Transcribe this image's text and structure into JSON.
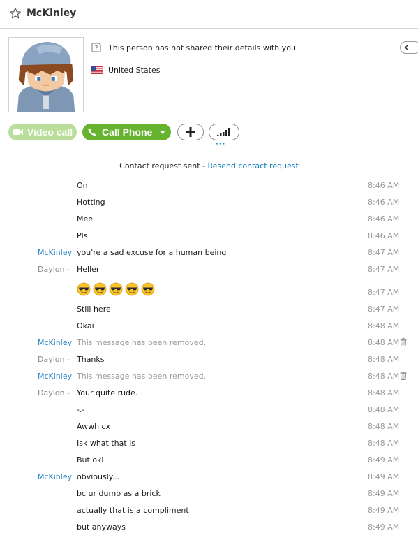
{
  "header": {
    "contact_name": "McKinley",
    "favorite_icon": "star-icon"
  },
  "profile": {
    "details_notice": "This person has not shared their details with you.",
    "country": "United States",
    "flag": "us-flag-icon",
    "avatar": "pixel-art-avatar"
  },
  "actions": {
    "video_call_label": "Video call",
    "call_phone_label": "Call Phone",
    "add_icon": "plus-icon",
    "signal_icon": "signal-icon",
    "colors": {
      "video_disabled": "#b9df9a",
      "call": "#65b32e"
    }
  },
  "conversation": {
    "contact_request_text": "Contact request sent - ",
    "resend_link": "Resend contact request",
    "messages": [
      {
        "sender": "",
        "text": "On",
        "time": "8:46 AM"
      },
      {
        "sender": "",
        "text": "Hotting",
        "time": "8:46 AM"
      },
      {
        "sender": "",
        "text": "Mee",
        "time": "8:46 AM"
      },
      {
        "sender": "",
        "text": "Pls",
        "time": "8:46 AM"
      },
      {
        "sender": "McKinley",
        "text": "you're a sad excuse for a human being",
        "time": "8:47 AM"
      },
      {
        "sender": "Daylon -",
        "text": "Heller",
        "time": "8:47 AM"
      },
      {
        "sender": "",
        "text": "",
        "emoji": "sunglasses-emoji",
        "emoji_count": 5,
        "time": "8:47 AM"
      },
      {
        "sender": "",
        "text": "Still here",
        "time": "8:47 AM"
      },
      {
        "sender": "",
        "text": "Okai",
        "time": "8:48 AM"
      },
      {
        "sender": "McKinley",
        "text": "This message has been removed.",
        "removed": true,
        "time": "8:48 AM"
      },
      {
        "sender": "Daylon -",
        "text": "Thanks",
        "time": "8:48 AM"
      },
      {
        "sender": "McKinley",
        "text": "This message has been removed.",
        "removed": true,
        "time": "8:48 AM"
      },
      {
        "sender": "Daylon -",
        "text": "Your quite rude.",
        "time": "8:48 AM"
      },
      {
        "sender": "",
        "text": "-.-",
        "time": "8:48 AM"
      },
      {
        "sender": "",
        "text": "Awwh cx",
        "time": "8:48 AM"
      },
      {
        "sender": "",
        "text": "Isk what that is",
        "time": "8:48 AM"
      },
      {
        "sender": "",
        "text": "But oki",
        "time": "8:49 AM"
      },
      {
        "sender": "McKinley",
        "text": "obviously...",
        "time": "8:49 AM"
      },
      {
        "sender": "",
        "text": "bc ur dumb as a brick",
        "time": "8:49 AM"
      },
      {
        "sender": "",
        "text": "actually that is a compliment",
        "time": "8:49 AM"
      },
      {
        "sender": "",
        "text": "but anyways",
        "time": "8:49 AM"
      }
    ]
  }
}
